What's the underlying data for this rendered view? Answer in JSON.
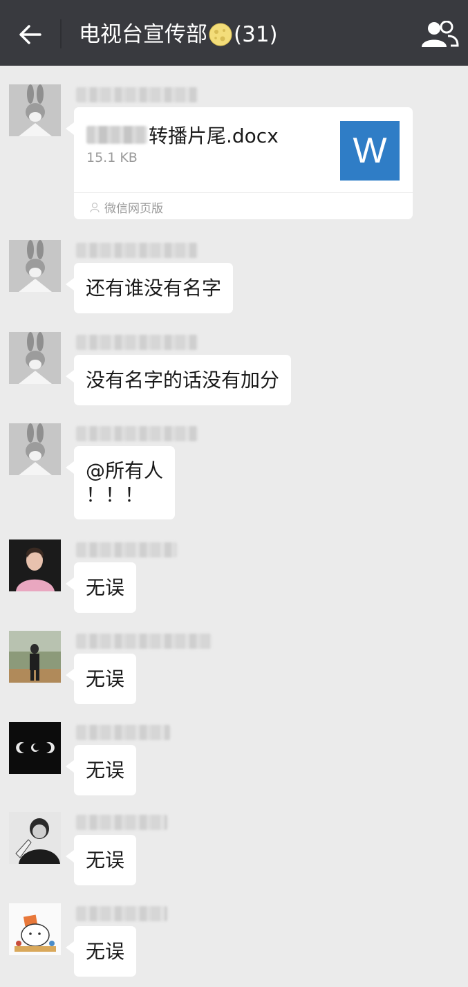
{
  "header": {
    "title": "电视台宣传部",
    "member_count": "(31)",
    "back_icon": "back-arrow-icon",
    "group_icon": "group-members-icon",
    "background": "#393a3f"
  },
  "file_message": {
    "file_name": "转播片尾.docx",
    "file_size": "15.1 KB",
    "app_icon_letter": "W",
    "source": "微信网页版",
    "icon_color": "#2f7dc6"
  },
  "messages": [
    {
      "text": "还有谁没有名字"
    },
    {
      "text": "没有名字的话没有加分"
    },
    {
      "line1": "@所有人",
      "line2": "！！！"
    },
    {
      "text": "无误"
    },
    {
      "text": "无误"
    },
    {
      "text": "无误"
    },
    {
      "text": "无误"
    },
    {
      "text": "无误"
    }
  ]
}
